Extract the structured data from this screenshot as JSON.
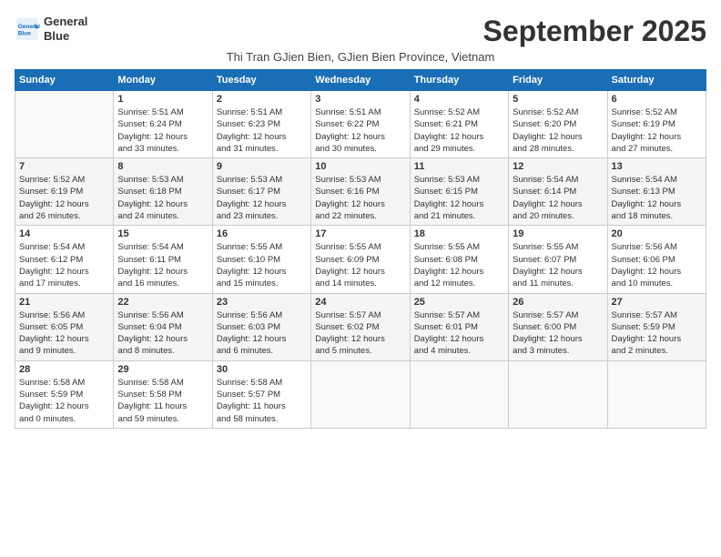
{
  "header": {
    "logo_line1": "General",
    "logo_line2": "Blue",
    "month": "September 2025",
    "subtitle": "Thi Tran GJien Bien, GJien Bien Province, Vietnam"
  },
  "weekdays": [
    "Sunday",
    "Monday",
    "Tuesday",
    "Wednesday",
    "Thursday",
    "Friday",
    "Saturday"
  ],
  "weeks": [
    [
      {
        "day": "",
        "info": ""
      },
      {
        "day": "1",
        "info": "Sunrise: 5:51 AM\nSunset: 6:24 PM\nDaylight: 12 hours\nand 33 minutes."
      },
      {
        "day": "2",
        "info": "Sunrise: 5:51 AM\nSunset: 6:23 PM\nDaylight: 12 hours\nand 31 minutes."
      },
      {
        "day": "3",
        "info": "Sunrise: 5:51 AM\nSunset: 6:22 PM\nDaylight: 12 hours\nand 30 minutes."
      },
      {
        "day": "4",
        "info": "Sunrise: 5:52 AM\nSunset: 6:21 PM\nDaylight: 12 hours\nand 29 minutes."
      },
      {
        "day": "5",
        "info": "Sunrise: 5:52 AM\nSunset: 6:20 PM\nDaylight: 12 hours\nand 28 minutes."
      },
      {
        "day": "6",
        "info": "Sunrise: 5:52 AM\nSunset: 6:19 PM\nDaylight: 12 hours\nand 27 minutes."
      }
    ],
    [
      {
        "day": "7",
        "info": "Sunrise: 5:52 AM\nSunset: 6:19 PM\nDaylight: 12 hours\nand 26 minutes."
      },
      {
        "day": "8",
        "info": "Sunrise: 5:53 AM\nSunset: 6:18 PM\nDaylight: 12 hours\nand 24 minutes."
      },
      {
        "day": "9",
        "info": "Sunrise: 5:53 AM\nSunset: 6:17 PM\nDaylight: 12 hours\nand 23 minutes."
      },
      {
        "day": "10",
        "info": "Sunrise: 5:53 AM\nSunset: 6:16 PM\nDaylight: 12 hours\nand 22 minutes."
      },
      {
        "day": "11",
        "info": "Sunrise: 5:53 AM\nSunset: 6:15 PM\nDaylight: 12 hours\nand 21 minutes."
      },
      {
        "day": "12",
        "info": "Sunrise: 5:54 AM\nSunset: 6:14 PM\nDaylight: 12 hours\nand 20 minutes."
      },
      {
        "day": "13",
        "info": "Sunrise: 5:54 AM\nSunset: 6:13 PM\nDaylight: 12 hours\nand 18 minutes."
      }
    ],
    [
      {
        "day": "14",
        "info": "Sunrise: 5:54 AM\nSunset: 6:12 PM\nDaylight: 12 hours\nand 17 minutes."
      },
      {
        "day": "15",
        "info": "Sunrise: 5:54 AM\nSunset: 6:11 PM\nDaylight: 12 hours\nand 16 minutes."
      },
      {
        "day": "16",
        "info": "Sunrise: 5:55 AM\nSunset: 6:10 PM\nDaylight: 12 hours\nand 15 minutes."
      },
      {
        "day": "17",
        "info": "Sunrise: 5:55 AM\nSunset: 6:09 PM\nDaylight: 12 hours\nand 14 minutes."
      },
      {
        "day": "18",
        "info": "Sunrise: 5:55 AM\nSunset: 6:08 PM\nDaylight: 12 hours\nand 12 minutes."
      },
      {
        "day": "19",
        "info": "Sunrise: 5:55 AM\nSunset: 6:07 PM\nDaylight: 12 hours\nand 11 minutes."
      },
      {
        "day": "20",
        "info": "Sunrise: 5:56 AM\nSunset: 6:06 PM\nDaylight: 12 hours\nand 10 minutes."
      }
    ],
    [
      {
        "day": "21",
        "info": "Sunrise: 5:56 AM\nSunset: 6:05 PM\nDaylight: 12 hours\nand 9 minutes."
      },
      {
        "day": "22",
        "info": "Sunrise: 5:56 AM\nSunset: 6:04 PM\nDaylight: 12 hours\nand 8 minutes."
      },
      {
        "day": "23",
        "info": "Sunrise: 5:56 AM\nSunset: 6:03 PM\nDaylight: 12 hours\nand 6 minutes."
      },
      {
        "day": "24",
        "info": "Sunrise: 5:57 AM\nSunset: 6:02 PM\nDaylight: 12 hours\nand 5 minutes."
      },
      {
        "day": "25",
        "info": "Sunrise: 5:57 AM\nSunset: 6:01 PM\nDaylight: 12 hours\nand 4 minutes."
      },
      {
        "day": "26",
        "info": "Sunrise: 5:57 AM\nSunset: 6:00 PM\nDaylight: 12 hours\nand 3 minutes."
      },
      {
        "day": "27",
        "info": "Sunrise: 5:57 AM\nSunset: 5:59 PM\nDaylight: 12 hours\nand 2 minutes."
      }
    ],
    [
      {
        "day": "28",
        "info": "Sunrise: 5:58 AM\nSunset: 5:59 PM\nDaylight: 12 hours\nand 0 minutes."
      },
      {
        "day": "29",
        "info": "Sunrise: 5:58 AM\nSunset: 5:58 PM\nDaylight: 11 hours\nand 59 minutes."
      },
      {
        "day": "30",
        "info": "Sunrise: 5:58 AM\nSunset: 5:57 PM\nDaylight: 11 hours\nand 58 minutes."
      },
      {
        "day": "",
        "info": ""
      },
      {
        "day": "",
        "info": ""
      },
      {
        "day": "",
        "info": ""
      },
      {
        "day": "",
        "info": ""
      }
    ]
  ]
}
